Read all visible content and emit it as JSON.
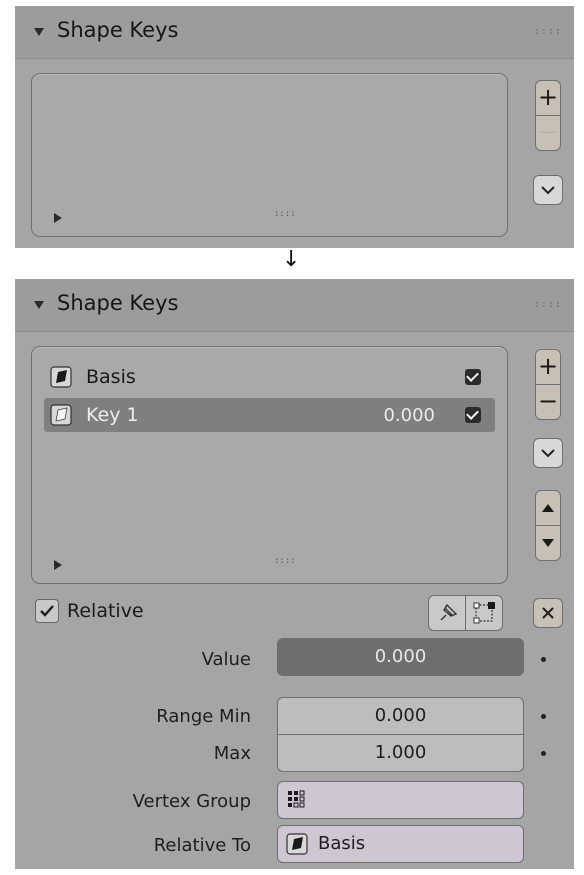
{
  "top_panel": {
    "title": "Shape Keys",
    "add_label": "+",
    "remove_label": "—"
  },
  "transition_arrow": "↓",
  "bottom_panel": {
    "title": "Shape Keys",
    "add_label": "+",
    "remove_label": "−",
    "keys": [
      {
        "name": "Basis",
        "value": "",
        "selected": false,
        "enabled": true
      },
      {
        "name": "Key 1",
        "value": "0.000",
        "selected": true,
        "enabled": true
      }
    ],
    "relative_label": "Relative",
    "relative_checked": true,
    "value_label": "Value",
    "value": "0.000",
    "range_min_label": "Range Min",
    "range_min": "0.000",
    "max_label": "Max",
    "max": "1.000",
    "vertex_group_label": "Vertex Group",
    "vertex_group_value": "",
    "relative_to_label": "Relative To",
    "relative_to_value": "Basis"
  },
  "icons": {
    "shape_key_icon": "shape-key-icon",
    "pin_icon": "pin-icon",
    "edit_mode_icon": "edit-mode-icon",
    "vertex_group_icon": "vertex-group-icon"
  },
  "colors": {
    "panel_bg": "#a5a5a5",
    "selected_row": "#7f7f7f",
    "button_bg": "#c9c0b5",
    "picker_bg": "#cfc6d4"
  }
}
